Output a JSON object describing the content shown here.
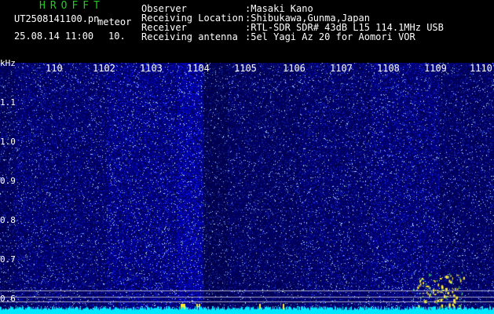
{
  "header": {
    "brand": "HROFFT",
    "filename": "UT2508141100.pn",
    "filename_suffix": "meteor",
    "datetime": "25.08.14 11:00",
    "count": "10.",
    "fields": [
      {
        "label": "Observer",
        "value": ":Masaki Kano"
      },
      {
        "label": "Receiving Location",
        "value": ":Shibukawa,Gunma,Japan"
      },
      {
        "label": "Receiver",
        "value": ":RTL-SDR SDR# 43dB L15 114.1MHz USB"
      },
      {
        "label": "Receiving antenna",
        "value": ":5el Yagi Az 20 for Aomori VOR"
      }
    ]
  },
  "spectrogram": {
    "unit": "kHz",
    "x_ticks": [
      "110",
      "1102",
      "1103",
      "1104",
      "1105",
      "1106",
      "1107",
      "1108",
      "1109",
      "1110"
    ],
    "y_ticks": [
      "1.1",
      "1.0",
      "0.9",
      "0.8",
      "0.7",
      "0.6"
    ],
    "colors": {
      "background": "#000044",
      "noise": "#2a3cff",
      "signal": "#e0f0ff",
      "meteor": "#ffee33",
      "baseline": "#00e8ff"
    }
  }
}
